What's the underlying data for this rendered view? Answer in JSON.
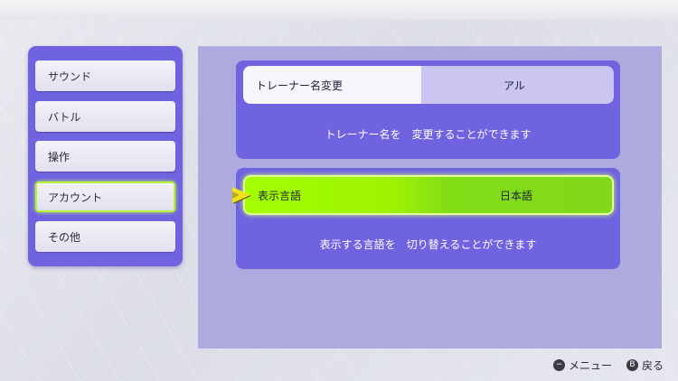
{
  "menu": {
    "items": [
      {
        "label": "サウンド",
        "active": false
      },
      {
        "label": "バトル",
        "active": false
      },
      {
        "label": "操作",
        "active": false
      },
      {
        "label": "アカウント",
        "active": true
      },
      {
        "label": "その他",
        "active": false
      }
    ]
  },
  "settings": [
    {
      "name": "トレーナー名変更",
      "value": "アル",
      "description": "トレーナー名を　変更することができます"
    },
    {
      "name": "表示言語",
      "value": "日本語",
      "description": "表示する言語を　切り替えることができます"
    }
  ],
  "hints": {
    "menu_glyph": "−",
    "menu_label": "メニュー",
    "back_glyph": "B",
    "back_label": "戻る"
  },
  "colors": {
    "panel_purple": "#6f63e0",
    "selected_green": "#a2ff00",
    "cursor_yellow": "#f1e21a"
  },
  "icons": [
    "selection-cursor-icon",
    "minus-button-icon",
    "b-button-icon"
  ]
}
